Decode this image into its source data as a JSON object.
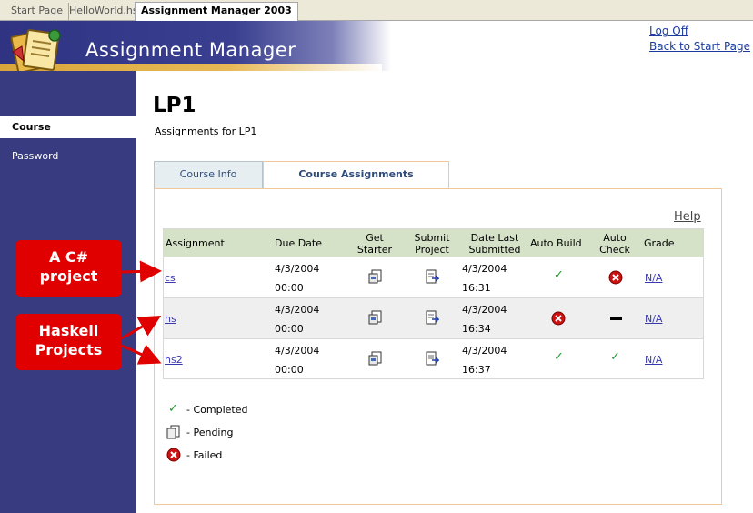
{
  "tabs": [
    {
      "label": "Start Page"
    },
    {
      "label": "HelloWorld.hs"
    },
    {
      "label": "Assignment Manager 2003"
    }
  ],
  "header": {
    "app_title": "Assignment Manager",
    "log_off": "Log Off",
    "back_to_start": "Back to Start Page"
  },
  "sidebar": {
    "items": [
      {
        "label": "Course",
        "active": true
      },
      {
        "label": "Password",
        "active": false
      }
    ]
  },
  "main": {
    "title": "LP1",
    "subtitle": "Assignments for LP1",
    "tabs": [
      {
        "label": "Course Info"
      },
      {
        "label": "Course Assignments",
        "selected": true
      }
    ],
    "help": "Help"
  },
  "table": {
    "columns": [
      "Assignment",
      "Due Date",
      "Get Starter",
      "Submit Project",
      "Date Last Submitted",
      "Auto Build",
      "Auto Check",
      "Grade"
    ],
    "column_lines": {
      "get_starter": [
        "Get",
        "Starter"
      ],
      "submit_project": [
        "Submit",
        "Project"
      ],
      "date_last_submitted": [
        "Date Last",
        "Submitted"
      ],
      "auto_check": [
        "Auto",
        "Check"
      ]
    },
    "rows": [
      {
        "name": "cs",
        "due_date": "4/3/2004",
        "due_time": "00:00",
        "submitted_date": "4/3/2004",
        "submitted_time": "16:31",
        "auto_build": "completed",
        "auto_check": "failed",
        "grade": "N/A"
      },
      {
        "name": "hs",
        "due_date": "4/3/2004",
        "due_time": "00:00",
        "submitted_date": "4/3/2004",
        "submitted_time": "16:34",
        "auto_build": "failed",
        "auto_check": "none",
        "grade": "N/A"
      },
      {
        "name": "hs2",
        "due_date": "4/3/2004",
        "due_time": "00:00",
        "submitted_date": "4/3/2004",
        "submitted_time": "16:37",
        "auto_build": "completed",
        "auto_check": "completed",
        "grade": "N/A"
      }
    ]
  },
  "legend": {
    "completed": "- Completed",
    "pending": "- Pending",
    "failed": "- Failed"
  },
  "callouts": {
    "csharp_line1": "A C#",
    "csharp_line2": "project",
    "haskell_line1": "Haskell",
    "haskell_line2": "Projects"
  },
  "colors": {
    "sidebar": "#383b80",
    "header_band": "#2f3382",
    "accent_stripe": "#d9a63b",
    "table_header": "#d5e2c8",
    "callout": "#e00000",
    "check": "#1a9c2a",
    "fail": "#cc1111"
  }
}
